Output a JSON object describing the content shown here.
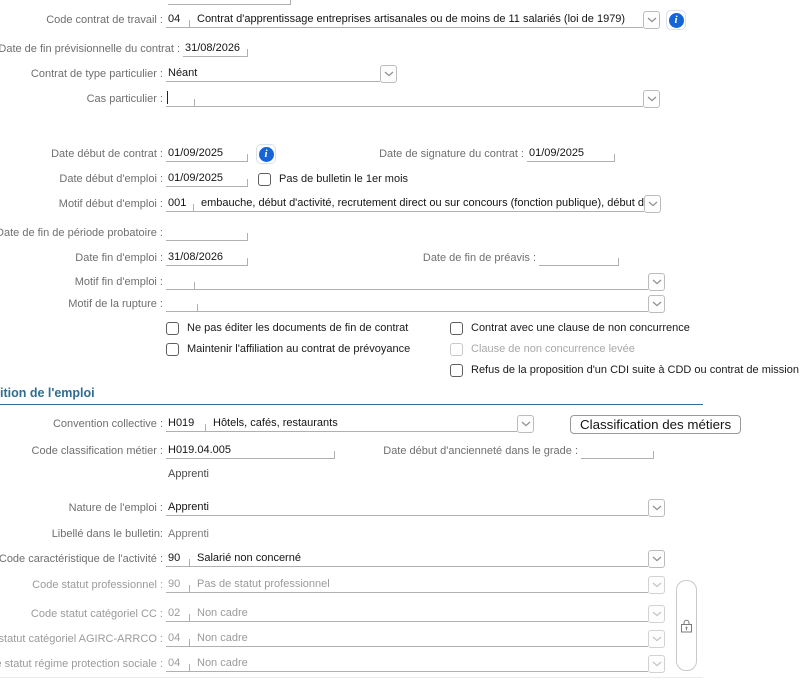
{
  "colors": {
    "info_blue": "#1565d8",
    "section_teal": "#2e6e91"
  },
  "icons": {
    "info": "info-icon",
    "chevron": "chevron-down-icon",
    "lock": "lock-icon"
  },
  "section": {
    "title": "ition de l'emploi"
  },
  "buttons": {
    "classification_metiers": "Classification des métiers"
  },
  "fields": {
    "code_contrat_travail": {
      "label": "Code contrat de travail :",
      "code": "04",
      "desc": "Contrat d'apprentissage entreprises artisanales ou de moins de 11 salariés (loi de 1979)"
    },
    "date_fin_previsionnelle": {
      "label": "Date de fin prévisionnelle du contrat :",
      "value": "31/08/2026"
    },
    "contrat_type_particulier": {
      "label": "Contrat de type particulier :",
      "value": "Néant"
    },
    "cas_particulier": {
      "label": "Cas particulier :",
      "value": ""
    },
    "date_debut_contrat": {
      "label": "Date début de contrat :",
      "value": "01/09/2025"
    },
    "date_signature_contrat": {
      "label": "Date de signature du contrat :",
      "value": "01/09/2025"
    },
    "date_debut_emploi": {
      "label": "Date début d'emploi :",
      "value": "01/09/2025"
    },
    "motif_debut_emploi": {
      "label": "Motif début d'emploi :",
      "code": "001",
      "desc": "embauche, début d'activité, recrutement direct ou sur concours (fonction publique), début de c"
    },
    "date_fin_periode_probatoire": {
      "label": "Date de fin de période probatoire :",
      "value": ""
    },
    "date_fin_emploi": {
      "label": "Date fin d'emploi :",
      "value": "31/08/2026"
    },
    "date_fin_preavis": {
      "label": "Date de fin de préavis :",
      "value": ""
    },
    "motif_fin_emploi": {
      "label": "Motif fin d'emploi :",
      "value": ""
    },
    "motif_rupture": {
      "label": "Motif de la rupture :",
      "value": ""
    },
    "convention_collective": {
      "label": "Convention collective :",
      "code": "H019",
      "desc": "Hôtels, cafés, restaurants"
    },
    "code_classification_metier": {
      "label": "Code classification métier :",
      "value": "H019.04.005",
      "note": "Apprenti"
    },
    "date_debut_anciennete": {
      "label": "Date début d'ancienneté dans le grade :",
      "value": ""
    },
    "nature_emploi": {
      "label": "Nature de l'emploi :",
      "value": "Apprenti"
    },
    "libelle_bulletin": {
      "label": "Libellé dans le bulletin:",
      "value": "Apprenti"
    },
    "code_caracteristique_activite": {
      "label": "Code caractéristique de l'activité :",
      "code": "90",
      "desc": "Salarié non concerné"
    },
    "code_statut_professionnel": {
      "label": "Code statut professionnel :",
      "code": "90",
      "desc": "Pas de statut professionnel"
    },
    "code_statut_categoriel_cc": {
      "label": "Code statut catégoriel CC :",
      "code": "02",
      "desc": "Non cadre"
    },
    "statut_categoriel_agirc_arrco": {
      "label": "statut catégoriel AGIRC-ARRCO :",
      "code": "04",
      "desc": "Non cadre"
    },
    "statut_regime_protection_sociale": {
      "label": "e statut régime protection sociale :",
      "code": "04",
      "desc": "Non cadre"
    }
  },
  "checkboxes": {
    "pas_de_bulletin": {
      "label": "Pas de bulletin le 1er mois",
      "checked": false
    },
    "ne_pas_editer_documents": {
      "label": "Ne pas éditer les documents de fin de contrat",
      "checked": false
    },
    "maintenir_affiliation_prevoyance": {
      "label": "Maintenir l'affiliation au contrat de prévoyance",
      "checked": false
    },
    "contrat_clause_non_concurrence": {
      "label": "Contrat avec une clause de non concurrence",
      "checked": false
    },
    "clause_non_concurrence_levee": {
      "label": "Clause de non concurrence levée",
      "checked": false,
      "disabled": true
    },
    "refus_proposition_cdi": {
      "label": "Refus de la proposition d'un CDI suite à CDD ou contrat de mission",
      "checked": false
    }
  }
}
